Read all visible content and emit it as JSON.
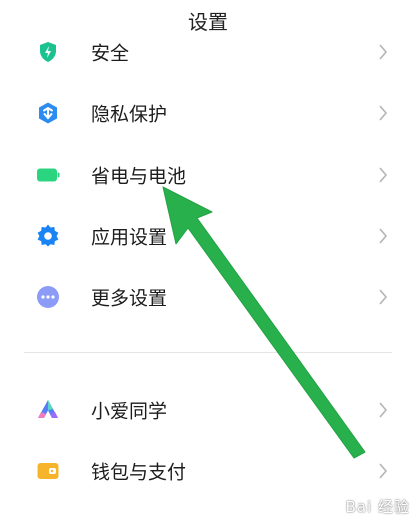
{
  "header": {
    "title": "设置"
  },
  "items": [
    {
      "label": "安全",
      "icon": "shield-bolt-icon",
      "color": "#19c28e"
    },
    {
      "label": "隐私保护",
      "icon": "privacy-hex-icon",
      "color": "#2d8cf0"
    },
    {
      "label": "省电与电池",
      "icon": "battery-icon",
      "color": "#2bd47f"
    },
    {
      "label": "应用设置",
      "icon": "gear-icon",
      "color": "#1a84f5"
    },
    {
      "label": "更多设置",
      "icon": "more-dots-icon",
      "color": "#8c9cf6"
    },
    {
      "label": "小爱同学",
      "icon": "xiaoai-icon",
      "color": "#5b7cf7"
    },
    {
      "label": "钱包与支付",
      "icon": "wallet-icon",
      "color": "#f6b42b"
    }
  ],
  "annotation": {
    "arrow_color": "#27b04b"
  },
  "watermark": {
    "text": "Bai 经验"
  }
}
